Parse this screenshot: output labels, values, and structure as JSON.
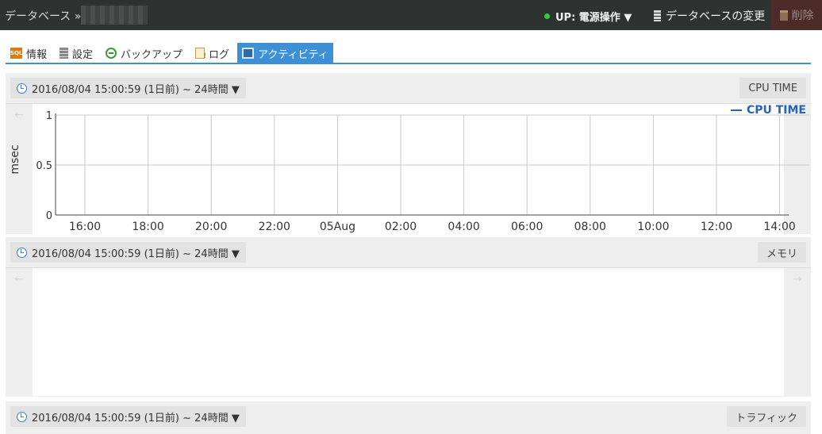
{
  "header": {
    "breadcrumb": "データベース »",
    "status_label": "UP: 電源操作 ▼",
    "status_color": "#2ecc40",
    "change_db_label": "データベースの変更",
    "delete_label": "削除"
  },
  "tabs": [
    {
      "label": "情報",
      "icon": "sql-icon",
      "active": false
    },
    {
      "label": "設定",
      "icon": "settings-icon",
      "active": false
    },
    {
      "label": "バックアップ",
      "icon": "backup-icon",
      "active": false
    },
    {
      "label": "ログ",
      "icon": "log-icon",
      "active": false
    },
    {
      "label": "アクティビティ",
      "icon": "activity-icon",
      "active": true
    }
  ],
  "panels": [
    {
      "date_range": "2016/08/04 15:00:59 (1日前) ~ 24時間 ▼",
      "metric": "CPU TIME"
    },
    {
      "date_range": "2016/08/04 15:00:59 (1日前) ~ 24時間 ▼",
      "metric": "メモリ"
    },
    {
      "date_range": "2016/08/04 15:00:59 (1日前) ~ 24時間 ▼",
      "metric": "トラフィック"
    }
  ],
  "nav": {
    "prev": "←",
    "next": "→"
  },
  "accent_color": "#3d8fd6",
  "chart_data": {
    "type": "line",
    "ylabel": "msec",
    "xlabel": "",
    "ylim": [
      0,
      1
    ],
    "yticks": [
      "0",
      "0.5",
      "1"
    ],
    "x_tick_labels": [
      "16:00",
      "18:00",
      "20:00",
      "22:00",
      "05Aug",
      "02:00",
      "04:00",
      "06:00",
      "08:00",
      "10:00",
      "12:00",
      "14:00"
    ],
    "grid": true,
    "legend_position": "top-right",
    "series": [
      {
        "name": "CPU TIME",
        "color": "#2a63b4",
        "values": []
      }
    ]
  }
}
